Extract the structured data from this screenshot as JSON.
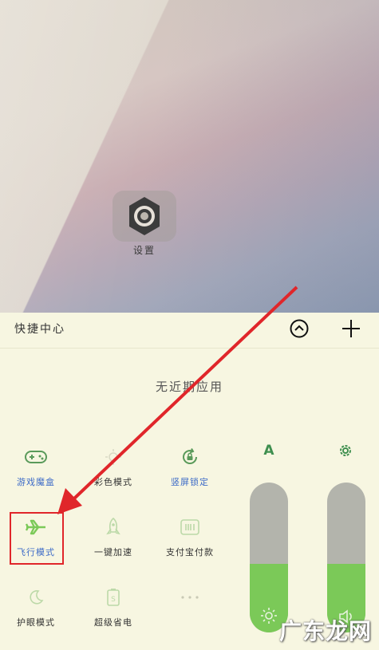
{
  "home": {
    "settings_app_label": "设置"
  },
  "panel": {
    "title": "快捷中心",
    "no_recent_text": "无近期应用",
    "tiles": [
      {
        "label": "游戏魔盒",
        "icon": "gamepad-icon"
      },
      {
        "label": "彩色模式",
        "icon": "color-mode-icon"
      },
      {
        "label": "竖屏锁定",
        "icon": "rotation-lock-icon"
      },
      {
        "label": "飞行模式",
        "icon": "airplane-icon"
      },
      {
        "label": "一键加速",
        "icon": "rocket-icon"
      },
      {
        "label": "支付宝付款",
        "icon": "barcode-pay-icon"
      },
      {
        "label": "护眼模式",
        "icon": "moon-icon"
      },
      {
        "label": "超级省电",
        "icon": "battery-saver-icon"
      }
    ],
    "font_size_label": "A",
    "brightness_level": 0.46,
    "volume_level": 0.46
  },
  "watermark": "广东龙网",
  "colors": {
    "panel_bg": "#f7f6e1",
    "accent_green": "#7bc958",
    "icon_green": "#5a9a5a",
    "highlight_red": "#e0262a",
    "label_blue": "#3d6bc7"
  }
}
